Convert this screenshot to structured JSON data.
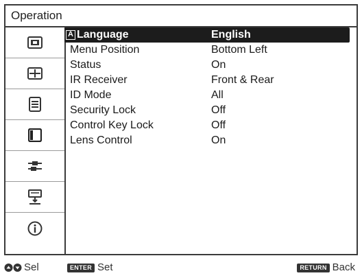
{
  "window": {
    "title": "Operation"
  },
  "sidebar": {
    "items": [
      {
        "icon": "picture-icon"
      },
      {
        "icon": "screen-icon"
      },
      {
        "icon": "setup-icon"
      },
      {
        "icon": "operation-icon",
        "active": true
      },
      {
        "icon": "connection-icon"
      },
      {
        "icon": "installation-icon"
      },
      {
        "icon": "information-icon"
      }
    ]
  },
  "menu": {
    "items": [
      {
        "label": "Language",
        "value": "English",
        "selected": true
      },
      {
        "label": "Menu Position",
        "value": "Bottom Left"
      },
      {
        "label": "Status",
        "value": "On"
      },
      {
        "label": "IR Receiver",
        "value": "Front & Rear"
      },
      {
        "label": "ID Mode",
        "value": "All"
      },
      {
        "label": "Security Lock",
        "value": "Off"
      },
      {
        "label": "Control Key Lock",
        "value": "Off"
      },
      {
        "label": "Lens Control",
        "value": "On"
      }
    ],
    "language_glyph": "A"
  },
  "footer": {
    "select_label": "Sel",
    "enter_key": "ENTER",
    "set_label": "Set",
    "return_key": "RETURN",
    "back_label": "Back"
  },
  "colors": {
    "frame": "#3a3a3a",
    "selected_bg": "#1c1c1c",
    "selected_text": "#ffffff"
  }
}
